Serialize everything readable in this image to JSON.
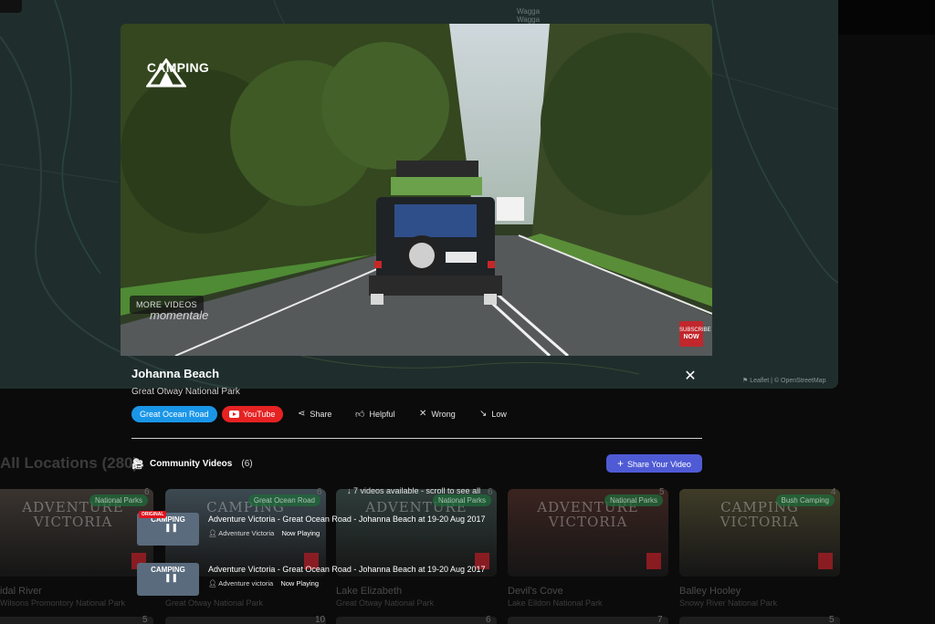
{
  "map": {
    "town": "Wagga\nWagga",
    "attribution": "⚑ Leaflet | © OpenStreetMap"
  },
  "grid": {
    "title": "All Locations (280)",
    "cards": [
      {
        "title": "ADVENTURE\nVICTORIA",
        "badge": "National Parks",
        "count": "6",
        "name": "idal River",
        "sub": "Wilsons Promontory National Park",
        "color": "#3a3430"
      },
      {
        "title": "CAMPING",
        "badge": "Great Ocean Road",
        "count": "6",
        "name": "",
        "sub": "Great Otway National Park",
        "color": "#3d4a52"
      },
      {
        "title": "ADVENTURE",
        "badge": "National Parks",
        "count": "6",
        "name": "Lake Elizabeth",
        "sub": "Great Otway National Park",
        "color": "#2f3d3a"
      },
      {
        "title": "ADVENTURE\nVICTORIA",
        "badge": "National Parks",
        "count": "5",
        "name": "Devil's Cove",
        "sub": "Lake Eildon National Park",
        "color": "#3b2420"
      },
      {
        "title": "CAMPING\nVICTORIA",
        "badge": "Bush Camping",
        "count": "4",
        "name": "Balley Hooley",
        "sub": "Snowy River National Park",
        "color": "#3f3c28"
      }
    ],
    "strip_counts": [
      "5",
      "10",
      "6",
      "7",
      "5"
    ]
  },
  "video": {
    "logo_label": "CAMPING",
    "more_videos": "MORE VIDEOS",
    "brand": "momentale",
    "subscribe_top": "SUBSCRIBE",
    "subscribe_now": "NOW"
  },
  "location": {
    "title": "Johanna Beach",
    "park": "Great Otway National Park",
    "tag": "Great Ocean Road",
    "youtube": "YouTube",
    "actions": {
      "share": "Share",
      "helpful": "Helpful",
      "wrong": "Wrong",
      "low": "Low"
    }
  },
  "community": {
    "label": "Community Videos",
    "count": "(6)",
    "share_button": "Share Your Video",
    "scroll_hint": "↓ 7 videos available - scroll to see all"
  },
  "videos": [
    {
      "title": "Adventure Victoria - Great Ocean Road - Johanna Beach at 19-20 Aug 2017",
      "author": "Adventure Victoria",
      "status": "Now Playing",
      "badge": "ORIGINAL",
      "thumb": "CAMPING"
    },
    {
      "title": "Adventure Victoria - Great Ocean Road - Johanna Beach at 19-20 Aug 2017",
      "author": "Adventure victoria",
      "status": "Now Playing",
      "badge": "",
      "thumb": "CAMPING"
    }
  ]
}
